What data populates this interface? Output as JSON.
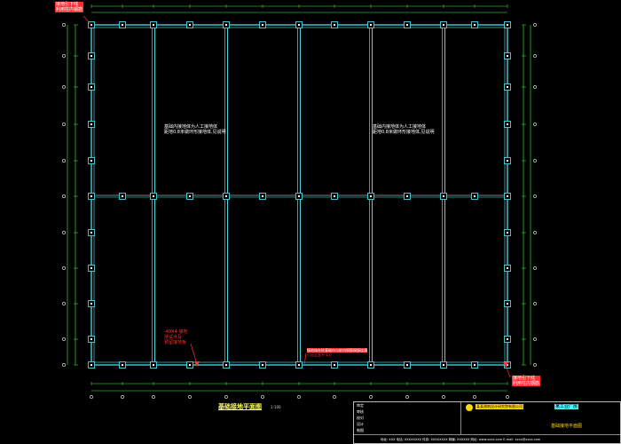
{
  "drawing": {
    "title": "基础接地平面图",
    "scale": "1:100"
  },
  "annotations": {
    "top_left_note": [
      "接地引下线",
      "利用柱内钢筋"
    ],
    "grid_note_left": [
      "基础内接地体为人工接地体",
      "距地0.8米做环形接地体,见说明"
    ],
    "grid_note_right": [
      "基础内接地体为人工接地体",
      "距地0.8米做环形接地体,见说明"
    ],
    "test_point_note": [
      "-40X4 接地",
      "测试点及",
      "预留接地板"
    ],
    "bottom_center_note": [
      "接地体在柱基础内与桩内钢筋焊接连通",
      "引出至室外-1.0"
    ],
    "bottom_right_note": [
      "接地引下线",
      "利用柱内钢筋"
    ]
  },
  "titleblock": {
    "company": "某某建筑设计研究院有限公司",
    "project": "某工业厂房",
    "sheet_title": "基础接地平面图",
    "footer": "地址: XXX   电话: XXXXXXXX   传真: XXXXXXXX   邮编: XXXXXX   网址: www.xxxx.com   E-mail: xxxx@xxxx.com",
    "rows": [
      "审定",
      "审核",
      "校对",
      "设计",
      "制图"
    ]
  },
  "colors": {
    "frame": "#4ff0ff",
    "grid": "#ffffff",
    "dimension": "#3aff3a",
    "annotation": "#ff3030",
    "background": "#000000"
  }
}
